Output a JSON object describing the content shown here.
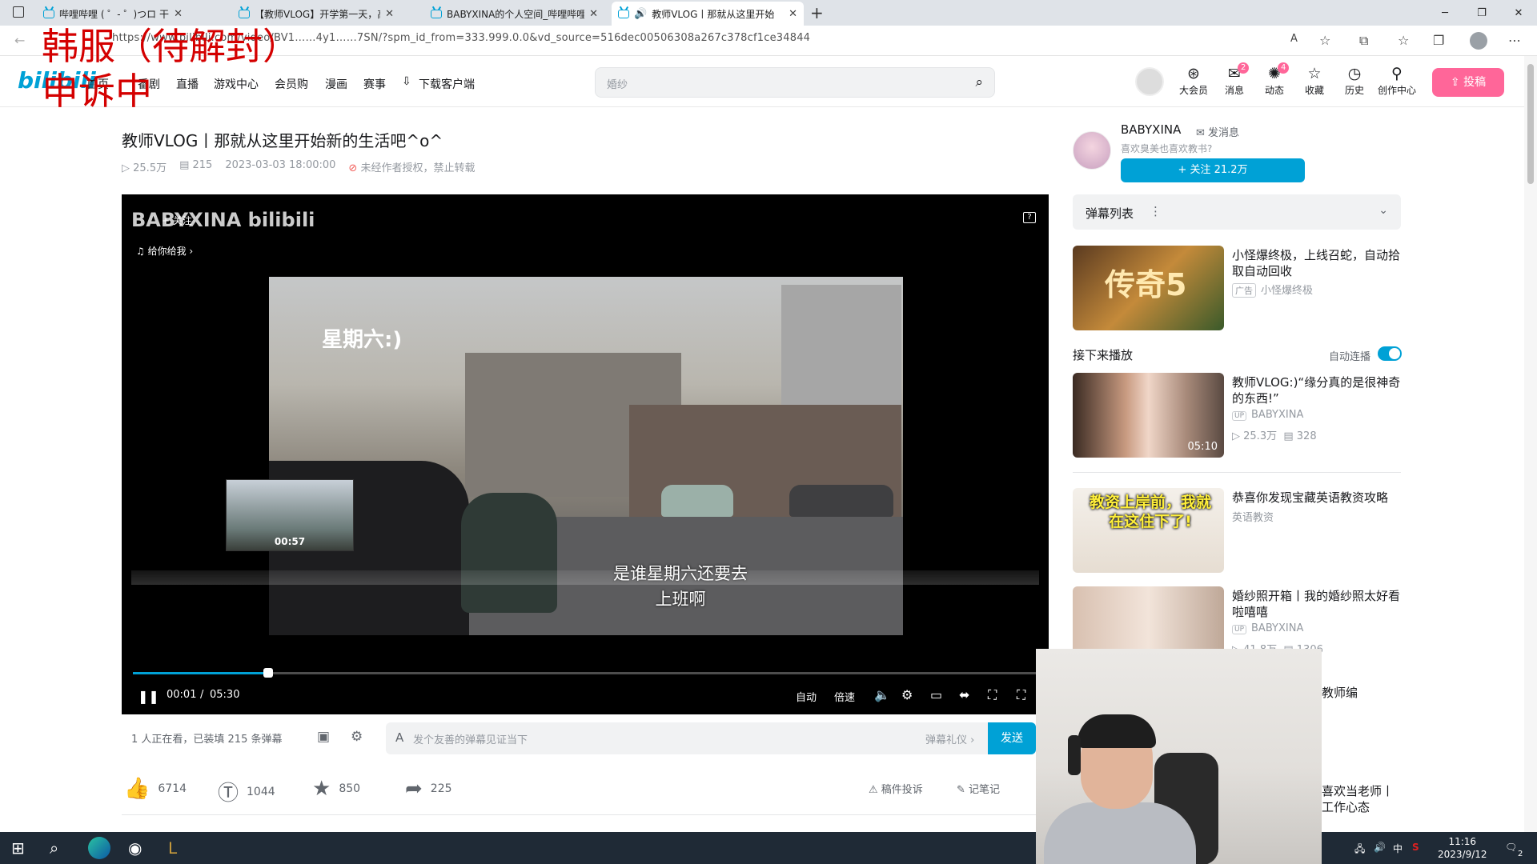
{
  "browser": {
    "tabs": [
      {
        "label": "哔哩哔哩 ( ゜- ゜)つロ 干杯~-bili"
      },
      {
        "label": "【教师VLOG】开学第一天，高中"
      },
      {
        "label": "BABYXINA的个人空间_哔哩哔哩"
      },
      {
        "label": "教师VLOG丨那就从这里开始"
      }
    ],
    "url": "https://www.bilibili.com/video/BV1……4y1……7SN/?spm_id_from=333.999.0.0&vd_source=516dec00506308a267c378cf1ce34844"
  },
  "overlay_text": {
    "line1": "韩服（待解封）",
    "line2": "申诉中"
  },
  "site": {
    "logo": "bilibili",
    "nav": [
      "首页",
      "番剧",
      "直播",
      "游戏中心",
      "会员购",
      "漫画",
      "赛事",
      "下载客户端"
    ],
    "search_placeholder": "婚纱",
    "header_icons": [
      {
        "label": "大会员",
        "icon": "vip-icon"
      },
      {
        "label": "消息",
        "icon": "message-icon",
        "badge": "2"
      },
      {
        "label": "动态",
        "icon": "dynamic-icon",
        "badge": "4"
      },
      {
        "label": "收藏",
        "icon": "star-icon"
      },
      {
        "label": "历史",
        "icon": "clock-icon"
      },
      {
        "label": "创作中心",
        "icon": "bulb-icon"
      }
    ],
    "upload_label": "投稿"
  },
  "video": {
    "title": "教师VLOG丨那就从这里开始新的生活吧^o^",
    "views": "25.5万",
    "danmaku_count": "215",
    "date": "2023-03-03 18:00:00",
    "copyright": "未经作者授权，禁止转载",
    "frame_text": "星期六:)",
    "subtitle_line1": "是谁星期六还要去",
    "subtitle_line2": "上班啊",
    "player_logo": "BABYXINA bilibili",
    "player_follow": "+ 关注",
    "player_music": "♫ 给你给我 ›",
    "preview_time": "00:57",
    "progress": 0.15,
    "time_current": "00:01",
    "time_sep": "/",
    "time_total": "05:30",
    "controls": [
      "自动",
      "倍速"
    ]
  },
  "danmaku_bar": {
    "status": "1 人正在看，已装填 215 条弹幕",
    "placeholder": "发个友善的弹幕见证当下",
    "etiquette": "弹幕礼仪 ›",
    "send": "发送"
  },
  "actions": {
    "like": "6714",
    "coin": "1044",
    "favorite": "850",
    "share": "225",
    "report": "稿件投诉",
    "note": "记笔记"
  },
  "uploader": {
    "name": "BABYXINA",
    "message": "发消息",
    "desc": "喜欢臭美也喜欢教书?",
    "follow": "+ 关注 21.2万"
  },
  "sidebar": {
    "danmaku_list": "弹幕列表",
    "next_play": "接下来播放",
    "autoplay": "自动连播",
    "ad": {
      "title": "小怪爆终极，上线召蛇，自动拾取自动回收",
      "tag": "广告",
      "author": "小怪爆终极",
      "thumb_text": "传奇5"
    },
    "videos": [
      {
        "title": "教师VLOG:)“缘分真的是很神奇的东西!”",
        "author": "BABYXINA",
        "views": "25.3万",
        "danmaku": "328",
        "duration": "05:10"
      },
      {
        "title": "恭喜你发现宝藏英语教资攻略",
        "author": "英语教资",
        "thumb_text": "教资上岸前，我就在这住下了!"
      },
      {
        "title": "婚纱照开箱丨我的婚纱照太好看啦嘻嘻",
        "author": "BABYXINA",
        "views": "41.8万",
        "danmaku": "1306"
      }
    ],
    "partial1": "教师编",
    "partial2a": "喜欢当老师丨",
    "partial2b": "工作心态"
  },
  "taskbar": {
    "time": "11:16",
    "date": "2023/9/12",
    "ime": "中",
    "notifications": "2"
  }
}
